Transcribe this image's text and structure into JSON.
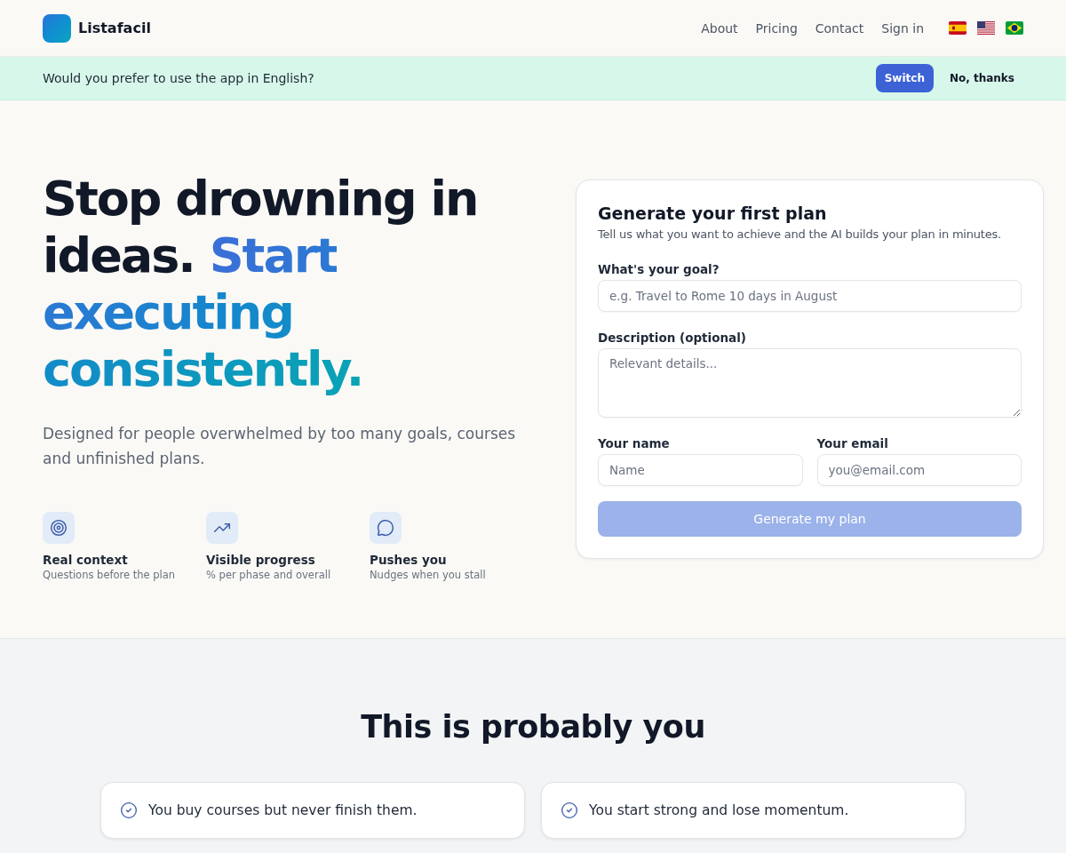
{
  "header": {
    "brand": "Listafacil",
    "nav": [
      "About",
      "Pricing",
      "Contact",
      "Sign in"
    ],
    "languages": [
      {
        "kind": "spain"
      },
      {
        "kind": "usa"
      },
      {
        "kind": "brazil"
      }
    ]
  },
  "banner": {
    "message": "Would you prefer to use the app in English?",
    "buttons": [
      {
        "label": "Switch",
        "kind": "primary"
      },
      {
        "label": "No, thanks",
        "kind": "plain"
      }
    ]
  },
  "hero": {
    "heading": "Stop drowning in ideas.",
    "heading_highlight": "Start executing consistently.",
    "subtitle": "Designed for people overwhelmed by too many goals, courses and unfinished plans.",
    "features": [
      {
        "kind": "target",
        "title": "Real context",
        "text": "Questions before the plan"
      },
      {
        "kind": "trend",
        "title": "Visible progress",
        "text": "% per phase and overall"
      },
      {
        "kind": "chat",
        "title": "Pushes you",
        "text": "Nudges when you stall"
      }
    ]
  },
  "form": {
    "title": "Generate your first plan",
    "subtitle": "Tell us what you want to achieve and the AI builds your plan in minutes.",
    "rows": [
      [
        {
          "kind": "input",
          "label": "What's your goal?",
          "placeholder": "e.g. Travel to Rome 10 days in August"
        }
      ],
      [
        {
          "kind": "textarea",
          "label": "Description (optional)",
          "placeholder": "Relevant details..."
        }
      ],
      [
        {
          "kind": "input",
          "label": "Your name",
          "placeholder": "Name"
        },
        {
          "kind": "input",
          "label": "Your email",
          "placeholder": "you@email.com"
        }
      ]
    ],
    "submit": {
      "label": "Generate my plan",
      "disabled": true
    }
  },
  "pains": {
    "title": "This is probably you",
    "items": [
      "You buy courses but never finish them.",
      "You start strong and lose momentum."
    ]
  }
}
